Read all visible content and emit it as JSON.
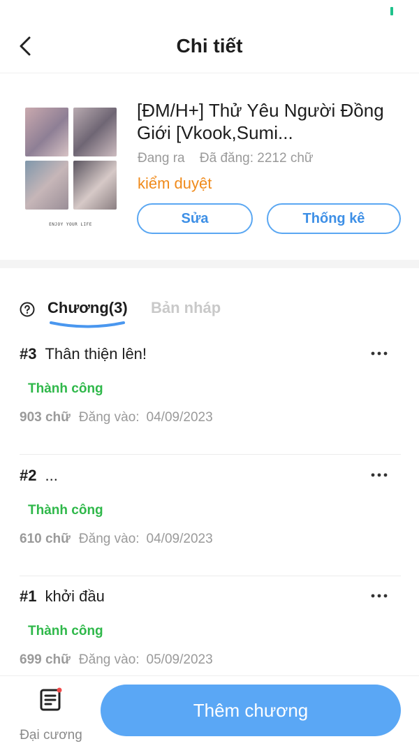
{
  "header": {
    "title": "Chi tiết",
    "back_icon": "chevron-left-icon"
  },
  "book": {
    "title": "[ĐM/H+] Thử Yêu Người Đồng Giới [Vkook,Sumi...",
    "status": "Đang ra",
    "word_count": "Đã đăng: 2212 chữ",
    "moderation": "kiểm duyệt",
    "edit_label": "Sửa",
    "stats_label": "Thống kê",
    "cover_caption": "ENJOY YOUR LIFE"
  },
  "tabs": {
    "chapters_label": "Chương(3)",
    "drafts_label": "Bản nháp",
    "help_icon": "question-circle-icon"
  },
  "chapters": [
    {
      "num": "#3",
      "title": "Thân thiện lên!",
      "status": "Thành công",
      "words": "903 chữ",
      "posted_label": "Đăng vào:",
      "date": "04/09/2023"
    },
    {
      "num": "#2",
      "title": "...",
      "status": "Thành công",
      "words": "610 chữ",
      "posted_label": "Đăng vào:",
      "date": "04/09/2023"
    },
    {
      "num": "#1",
      "title": "khởi đầu",
      "status": "Thành công",
      "words": "699 chữ",
      "posted_label": "Đăng vào:",
      "date": "05/09/2023"
    }
  ],
  "bottom": {
    "outline_label": "Đại cương",
    "outline_icon": "document-icon",
    "add_label": "Thêm chương"
  },
  "colors": {
    "accent": "#5aa7f5",
    "success": "#2fb84a",
    "warning": "#f08a1a",
    "badge": "#f04a4a"
  }
}
